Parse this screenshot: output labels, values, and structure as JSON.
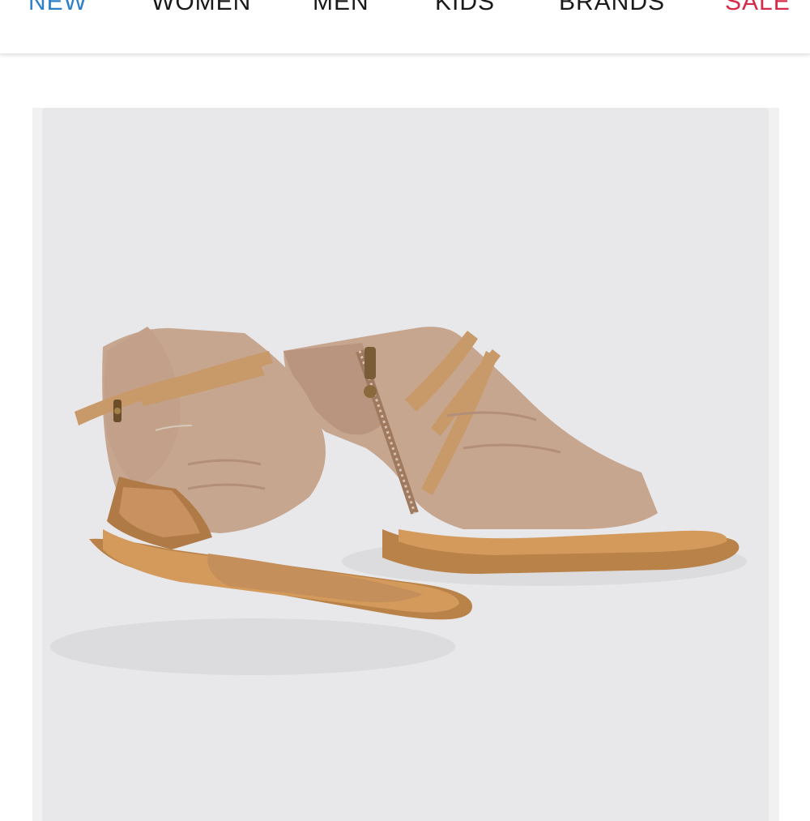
{
  "nav": {
    "items": [
      {
        "label": "NEW",
        "color": "#2f80c8"
      },
      {
        "label": "WOMEN",
        "color": "#1a1a1a"
      },
      {
        "label": "MEN",
        "color": "#1a1a1a"
      },
      {
        "label": "KIDS",
        "color": "#1a1a1a"
      },
      {
        "label": "BRANDS",
        "color": "#1a1a1a"
      },
      {
        "label": "SALE",
        "color": "#d62a4a"
      }
    ]
  },
  "product": {
    "image_icon": "sandal-pair-image",
    "shoe_color": "#c7a690",
    "strap_color": "#c89a6a",
    "sole_color": "#b98248"
  }
}
